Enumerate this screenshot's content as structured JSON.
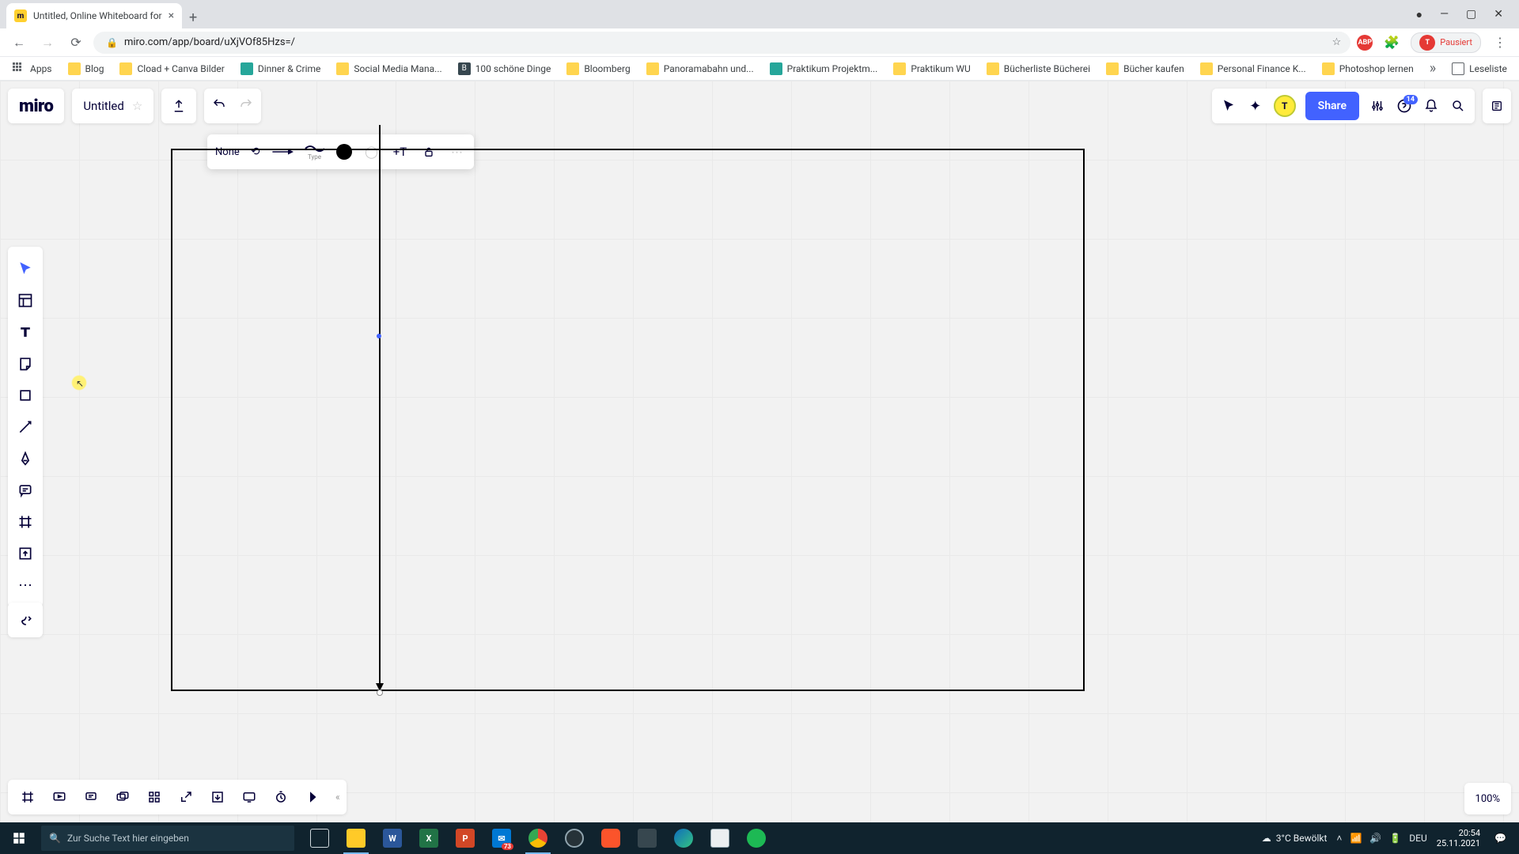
{
  "browser": {
    "tab_title": "Untitled, Online Whiteboard for",
    "url": "miro.com/app/board/uXjVOf85Hzs=/",
    "pause_label": "Pausiert",
    "new_tab": "+",
    "star": "☆",
    "more": "»",
    "reading_list": "Leseliste"
  },
  "bookmarks": [
    {
      "label": "Apps",
      "variant": "grid"
    },
    {
      "label": "Blog"
    },
    {
      "label": "Cload + Canva Bilder"
    },
    {
      "label": "Dinner & Crime",
      "variant": "teal"
    },
    {
      "label": "Social Media Mana..."
    },
    {
      "label": "100 schöne Dinge",
      "variant": "dark"
    },
    {
      "label": "Bloomberg"
    },
    {
      "label": "Panoramabahn und..."
    },
    {
      "label": "Praktikum Projektm...",
      "variant": "teal"
    },
    {
      "label": "Praktikum WU"
    },
    {
      "label": "Bücherliste Bücherei"
    },
    {
      "label": "Bücher kaufen"
    },
    {
      "label": "Personal Finance K..."
    },
    {
      "label": "Photoshop lernen"
    }
  ],
  "miro": {
    "logo": "miro",
    "board_title": "Untitled",
    "share": "Share",
    "notif_count": "14",
    "avatar_initial": "T",
    "zoom": "100%"
  },
  "context_toolbar": {
    "start_label": "None",
    "type_label": "Type",
    "add_text": "+T"
  },
  "taskbar": {
    "search_placeholder": "Zur Suche Text hier eingeben",
    "weather": "3°C  Bewölkt",
    "lang": "DEU",
    "time": "20:54",
    "date": "25.11.2021",
    "badge": "73"
  }
}
